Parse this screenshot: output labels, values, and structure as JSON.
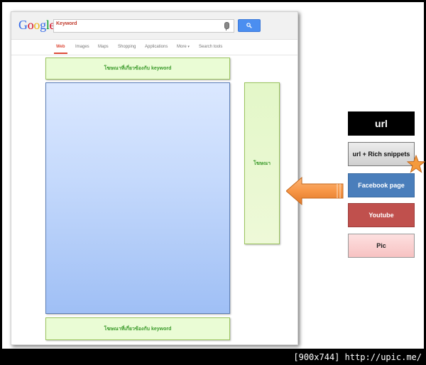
{
  "search": {
    "logo_text": "Google",
    "query": "Keyword"
  },
  "tabs": [
    {
      "label": "Web",
      "active": true
    },
    {
      "label": "Images",
      "active": false
    },
    {
      "label": "Maps",
      "active": false
    },
    {
      "label": "Shopping",
      "active": false
    },
    {
      "label": "Applications",
      "active": false
    },
    {
      "label": "More",
      "active": false
    },
    {
      "label": "Search tools",
      "active": false
    }
  ],
  "ads": {
    "top_label": "โฆษณาที่เกี่ยวข้องกับ keyword",
    "bottom_label": "โฆษณาที่เกี่ยวข้องกับ keyword",
    "side_label": "โฆษณา"
  },
  "legend": {
    "url": "url",
    "rich_snippets": "url + Rich snippets",
    "facebook": "Facebook page",
    "youtube": "Youtube",
    "pic": "Pic"
  },
  "colors": {
    "results_top": "#dbe8ff",
    "results_bottom": "#9fbff5",
    "ad_green": "#eafcd5",
    "arrow_orange": "#f79646",
    "facebook_blue": "#4a7ebb",
    "youtube_red": "#c0504d"
  },
  "footer": "[900x744] http://upic.me/"
}
